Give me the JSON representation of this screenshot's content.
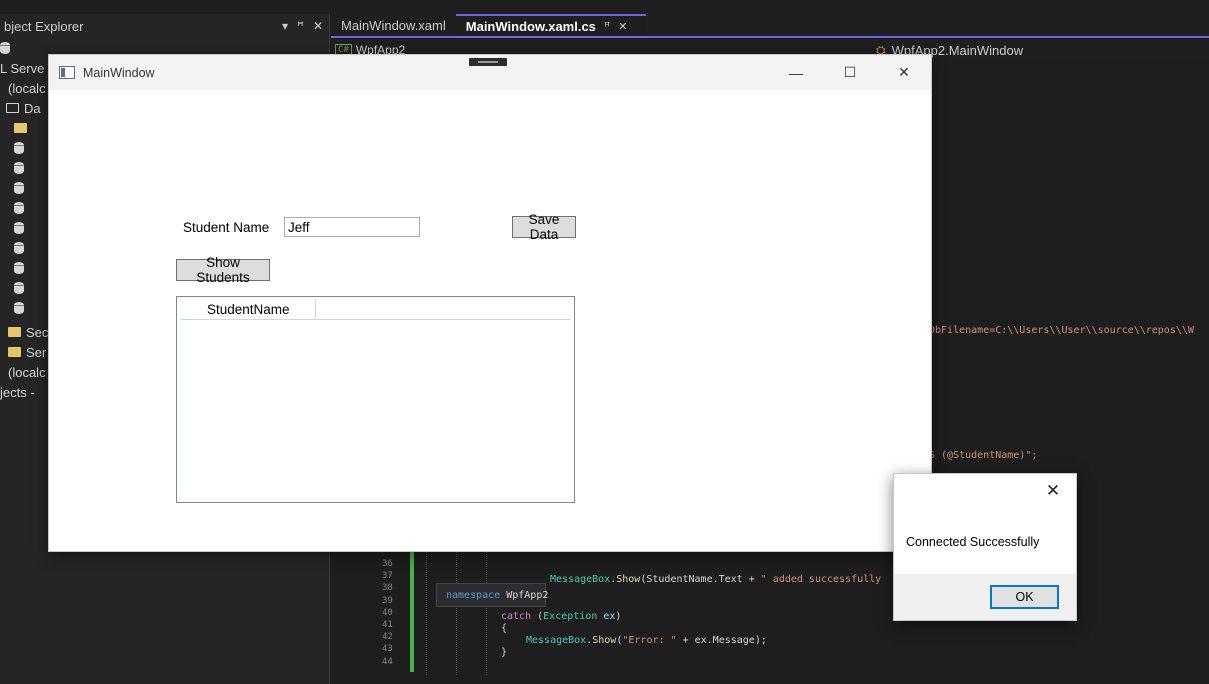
{
  "object_explorer": {
    "title": "bject Explorer",
    "header_controls": [
      "▾",
      "ꟸ",
      "✕"
    ],
    "rows": [
      {
        "label": "",
        "icon": "server-icon"
      },
      {
        "label": "L Serve",
        "icon": ""
      },
      {
        "label": "(localc",
        "icon": ""
      },
      {
        "label": "Da",
        "icon": "folder-open-icon"
      },
      {
        "label": "",
        "icon": "folder-icon"
      },
      {
        "label": "",
        "icon": "database-icon"
      },
      {
        "label": "",
        "icon": "database-icon"
      },
      {
        "label": "",
        "icon": "database-icon"
      },
      {
        "label": "",
        "icon": "database-icon"
      },
      {
        "label": "",
        "icon": "database-icon"
      },
      {
        "label": "",
        "icon": "database-icon"
      },
      {
        "label": "",
        "icon": "database-icon"
      },
      {
        "label": "",
        "icon": "database-icon"
      },
      {
        "label": "",
        "icon": "database-icon"
      },
      {
        "label": "Sec",
        "icon": "folder-icon"
      },
      {
        "label": "Ser",
        "icon": "folder-icon"
      },
      {
        "label": "(localc",
        "icon": ""
      },
      {
        "label": "jects -",
        "icon": ""
      }
    ]
  },
  "editor_tabs": [
    {
      "label": "MainWindow.xaml",
      "active": false
    },
    {
      "label": "MainWindow.xaml.cs",
      "active": true,
      "pin": "ꟸ",
      "close": "✕"
    }
  ],
  "nav_bar": {
    "project": "WpfApp2",
    "lang_badge": "C#",
    "class_path": "WpfApp2.MainWindow"
  },
  "code": {
    "line_numbers": [
      "36",
      "37",
      "38",
      "39",
      "40",
      "41",
      "42",
      "43",
      "44"
    ],
    "fragment_connection": "DbFilename=C:\\\\Users\\\\User\\\\source\\\\repos\\\\W",
    "fragment_values": "S (@StudentName)\";",
    "line_37": "MessageBox.Show(StudentName.Text + \" added successfully",
    "line_40": "catch (Exception ex)",
    "line_41": "{",
    "line_42": "MessageBox.Show(\"Error: \" + ex.Message);",
    "line_43": "}",
    "tooltip_keyword": "namespace",
    "tooltip_name": "WpfApp2"
  },
  "main_window": {
    "title": "MainWindow",
    "controls": {
      "minimize": "—",
      "maximize": "☐",
      "close": "✕"
    },
    "student_label": "Student Name",
    "student_value": "Jeff",
    "save_button": "Save Data",
    "show_button": "Show Students",
    "grid_columns": [
      "StudentName"
    ],
    "grid_rows": []
  },
  "message_box": {
    "close": "✕",
    "message": "Connected Successfully",
    "ok_button": "OK"
  },
  "colors": {
    "vs_background": "#1e1e1e",
    "vs_accent": "#7160e8",
    "change_bar": "#4caf50",
    "button_focus": "#0078d4"
  }
}
